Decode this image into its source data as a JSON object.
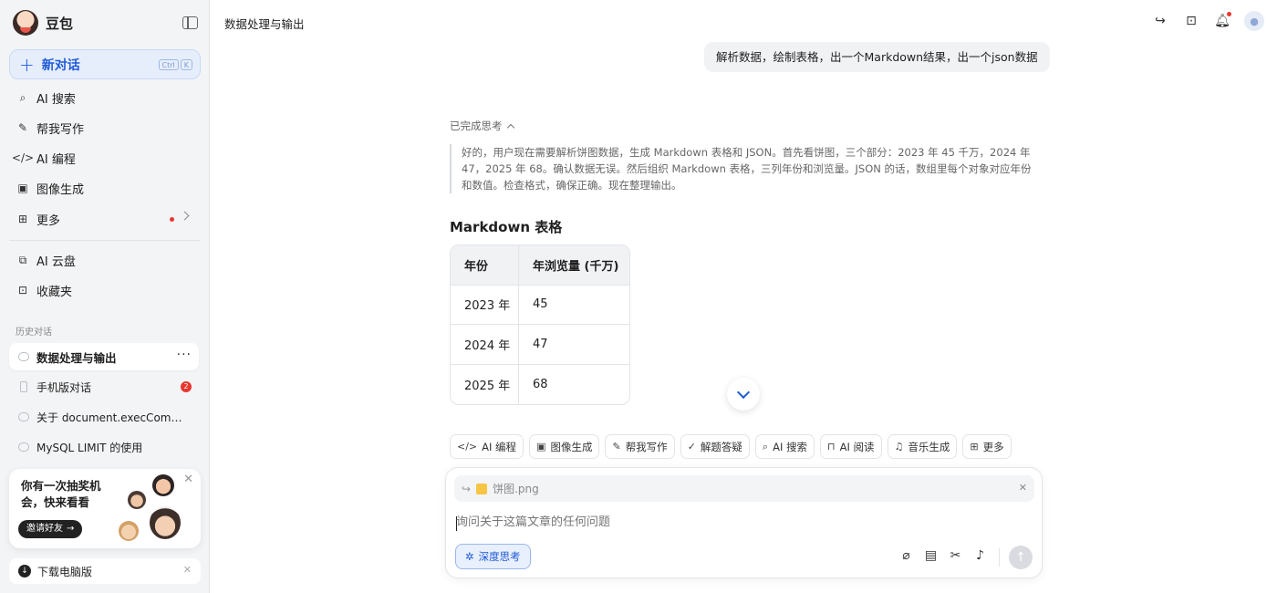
{
  "app": {
    "name": "豆包"
  },
  "sidebar": {
    "new_chat": "新对话",
    "shortcut": [
      "Ctrl",
      "K"
    ],
    "nav": [
      {
        "label": "AI 搜索",
        "icon": "search-icon"
      },
      {
        "label": "帮我写作",
        "icon": "pen-icon"
      },
      {
        "label": "AI 编程",
        "icon": "code-icon"
      },
      {
        "label": "图像生成",
        "icon": "image-icon"
      },
      {
        "label": "更多",
        "icon": "grid-icon"
      }
    ],
    "nav2": [
      {
        "label": "AI 云盘",
        "icon": "cloud-drive-icon"
      },
      {
        "label": "收藏夹",
        "icon": "bookmark-icon"
      }
    ],
    "history_label": "历史对话",
    "history": [
      {
        "title": "数据处理与输出",
        "active": true
      },
      {
        "title": "手机版对话",
        "badge": "2"
      },
      {
        "title": "关于 document.execCommand ..."
      },
      {
        "title": "MySQL LIMIT 的使用"
      }
    ],
    "promo": {
      "title": "你有一次抽奖机会，快来看看",
      "button": "邀请好友"
    },
    "download": "下载电脑版"
  },
  "header": {
    "title": "数据处理与输出"
  },
  "conversation": {
    "user_message": "解析数据，绘制表格，出一个Markdown结果，出一个json数据",
    "thinking_label": "已完成思考",
    "thinking_text": "好的，用户现在需要解析饼图数据，生成 Markdown 表格和 JSON。首先看饼图，三个部分：2023 年 45 千万，2024 年 47，2025 年 68。确认数据无误。然后组织 Markdown 表格，三列年份和浏览量。JSON 的话，数组里每个对象对应年份和数值。检查格式，确保正确。现在整理输出。",
    "section_title": "Markdown 表格",
    "table": {
      "headers": [
        "年份",
        "年浏览量 (千万)"
      ],
      "rows": [
        [
          "2023 年",
          "45"
        ],
        [
          "2024 年",
          "47"
        ],
        [
          "2025 年",
          "68"
        ]
      ]
    }
  },
  "tools": [
    {
      "label": "AI 编程",
      "icon": "code-icon"
    },
    {
      "label": "图像生成",
      "icon": "image-icon"
    },
    {
      "label": "帮我写作",
      "icon": "pen-icon"
    },
    {
      "label": "解题答疑",
      "icon": "solve-icon"
    },
    {
      "label": "AI 搜索",
      "icon": "search-icon"
    },
    {
      "label": "AI 阅读",
      "icon": "book-icon"
    },
    {
      "label": "音乐生成",
      "icon": "music-icon"
    },
    {
      "label": "更多",
      "icon": "grid-icon"
    }
  ],
  "composer": {
    "attachment": "饼图.png",
    "placeholder": "询问关于这篇文章的任何问题",
    "deep_think": "深度思考"
  }
}
